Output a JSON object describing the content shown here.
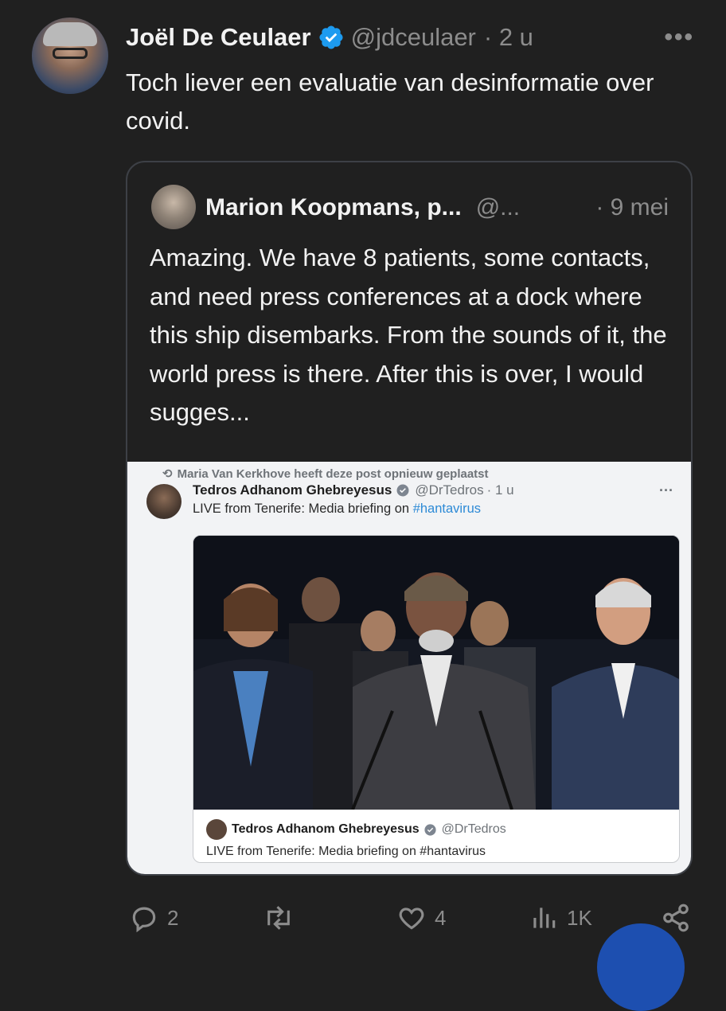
{
  "tweet": {
    "author_name": "Joël De Ceulaer",
    "handle": "@jdceulaer",
    "time": "· 2 u",
    "text": "Toch liever een evaluatie van desinformatie over covid.",
    "more_icon": "more-horizontal-icon"
  },
  "quoted": {
    "author_name": "Marion Koopmans, p...",
    "handle": "@...",
    "date": "· 9 mei",
    "text": "Amazing. We have 8 patients, some contacts, and need press conferences at a dock where this ship disembarks. From the sounds of it, the world press is there. After this is over, I would sugges..."
  },
  "embedded": {
    "repost_line": "Maria Van Kerkhove heeft deze post opnieuw geplaatst",
    "name": "Tedros Adhanom Ghebreyesus",
    "handle": "@DrTedros",
    "time": "· 1 u",
    "text_prefix": "LIVE from Tenerife: Media briefing on ",
    "hashtag": "#hantavirus",
    "card_name": "Tedros Adhanom Ghebreyesus",
    "card_handle": "@DrTedros",
    "card_text": "LIVE from Tenerife: Media briefing on #hantavirus"
  },
  "actions": {
    "replies": "2",
    "reposts": "",
    "likes": "4",
    "views": "1K"
  },
  "colors": {
    "background": "#202020",
    "verified": "#1d9bf0",
    "muted": "#8c8c8c",
    "hashtag": "#2d8ad6"
  }
}
